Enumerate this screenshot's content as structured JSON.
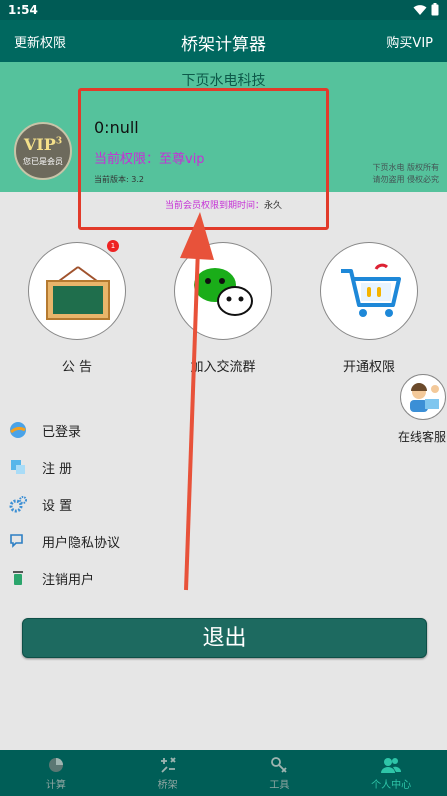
{
  "status": {
    "time": "1:54"
  },
  "appbar": {
    "left_label": "更新权限",
    "title": "桥架计算器",
    "right_label": "购买VIP"
  },
  "header": {
    "company": "下页水电科技",
    "user_id": "0:null",
    "permission": "当前权限：至尊vip",
    "version": "当前版本: 3.2",
    "copyright_line1": "下页水电 版权所有",
    "copyright_line2": "请勿盗用 侵权必究",
    "vip_text": "VIP",
    "vip_level": "3",
    "vip_sub": "您已是会员"
  },
  "expire": {
    "label": "当前会员权限到期时间：",
    "value": "永久"
  },
  "actions": [
    {
      "label": "公 告",
      "badge": "1"
    },
    {
      "label": "加入交流群"
    },
    {
      "label": "开通权限"
    }
  ],
  "service_label": "在线客服",
  "menu": [
    {
      "label": "已登录"
    },
    {
      "label": "注 册"
    },
    {
      "label": "设 置"
    },
    {
      "label": "用户隐私协议"
    },
    {
      "label": "注销用户"
    }
  ],
  "logout_label": "退出",
  "nav": [
    {
      "label": "计算"
    },
    {
      "label": "桥架"
    },
    {
      "label": "工具"
    },
    {
      "label": "个人中心",
      "active": true
    }
  ],
  "colors": {
    "primary": "#00685f",
    "panel": "#55c29c",
    "accent": "#c530d6",
    "highlight": "#e23a2a"
  }
}
